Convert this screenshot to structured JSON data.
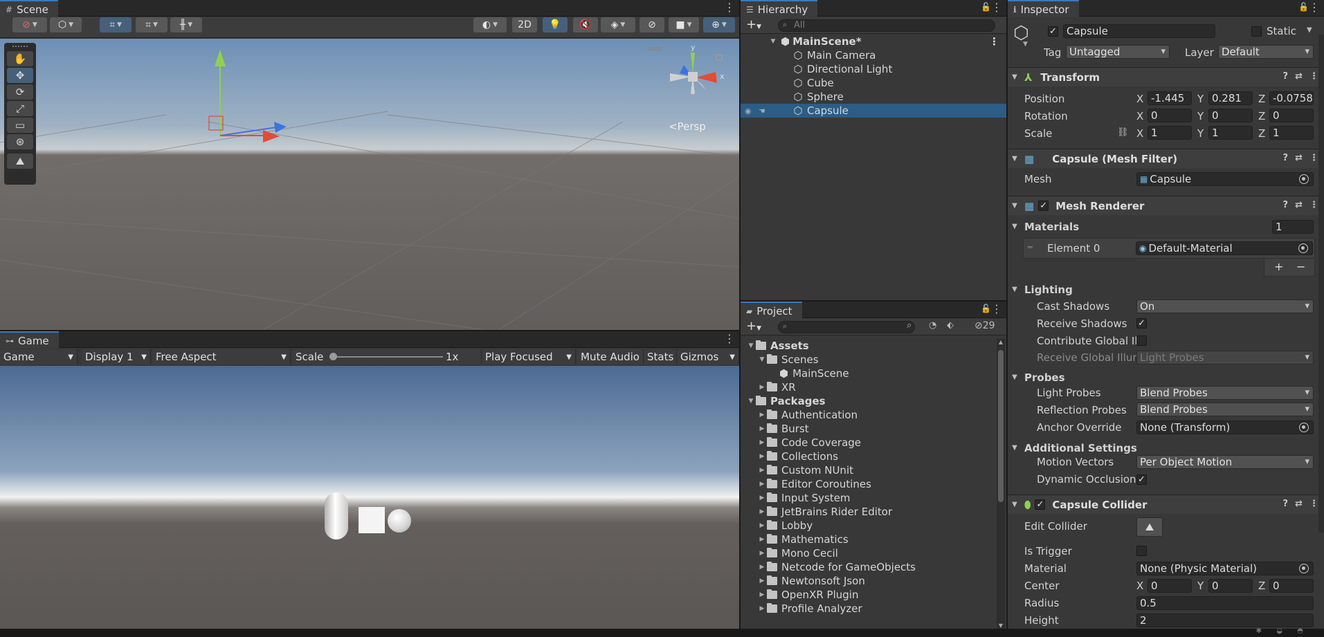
{
  "scene": {
    "tab": "Scene",
    "btn_2d": "2D",
    "persp": "Persp",
    "gizmo_y": "y",
    "gizmo_x": "x"
  },
  "game": {
    "tab": "Game",
    "mode": "Game",
    "display": "Display 1",
    "aspect": "Free Aspect",
    "scale_label": "Scale",
    "scale_value": "1x",
    "play_focused": "Play Focused",
    "mute": "Mute Audio",
    "stats": "Stats",
    "gizmos": "Gizmos"
  },
  "hierarchy": {
    "tab": "Hierarchy",
    "search_placeholder": "All",
    "scene_name": "MainScene*",
    "items": [
      "Main Camera",
      "Directional Light",
      "Cube",
      "Sphere",
      "Capsule"
    ],
    "selected": "Capsule"
  },
  "project": {
    "tab": "Project",
    "hidden_count": "29",
    "assets": "Assets",
    "scenes": "Scenes",
    "main_scene": "MainScene",
    "xr": "XR",
    "packages": "Packages",
    "package_items": [
      "Authentication",
      "Burst",
      "Code Coverage",
      "Collections",
      "Custom NUnit",
      "Editor Coroutines",
      "Input System",
      "JetBrains Rider Editor",
      "Lobby",
      "Mathematics",
      "Mono Cecil",
      "Netcode for GameObjects",
      "Newtonsoft Json",
      "OpenXR Plugin",
      "Profile Analyzer"
    ]
  },
  "inspector": {
    "tab": "Inspector",
    "object_name": "Capsule",
    "static": "Static",
    "tag_label": "Tag",
    "tag": "Untagged",
    "layer_label": "Layer",
    "layer": "Default",
    "transform": {
      "title": "Transform",
      "position_label": "Position",
      "rotation_label": "Rotation",
      "scale_label": "Scale",
      "position": {
        "x": "-1.445",
        "y": "0.281",
        "z": "-0.0758"
      },
      "rotation": {
        "x": "0",
        "y": "0",
        "z": "0"
      },
      "scale": {
        "x": "1",
        "y": "1",
        "z": "1"
      }
    },
    "mesh_filter": {
      "title": "Capsule (Mesh Filter)",
      "mesh_label": "Mesh",
      "mesh": "Capsule"
    },
    "mesh_renderer": {
      "title": "Mesh Renderer",
      "materials_label": "Materials",
      "materials_count": "1",
      "element_label": "Element 0",
      "element_value": "Default-Material",
      "add": "+",
      "remove": "−",
      "lighting_label": "Lighting",
      "cast_shadows_label": "Cast Shadows",
      "cast_shadows": "On",
      "receive_shadows_label": "Receive Shadows",
      "contribute_gi_label": "Contribute Global Il",
      "receive_gi_label": "Receive Global Illur",
      "receive_gi": "Light Probes",
      "probes_label": "Probes",
      "light_probes_label": "Light Probes",
      "light_probes": "Blend Probes",
      "reflection_probes_label": "Reflection Probes",
      "reflection_probes": "Blend Probes",
      "anchor_label": "Anchor Override",
      "anchor": "None (Transform)",
      "additional_label": "Additional Settings",
      "motion_vectors_label": "Motion Vectors",
      "motion_vectors": "Per Object Motion",
      "dynamic_occlusion_label": "Dynamic Occlusion"
    },
    "capsule_collider": {
      "title": "Capsule Collider",
      "edit_label": "Edit Collider",
      "trigger_label": "Is Trigger",
      "material_label": "Material",
      "material": "None (Physic Material)",
      "center_label": "Center",
      "center": {
        "x": "0",
        "y": "0",
        "z": "0"
      },
      "radius_label": "Radius",
      "radius": "0.5",
      "height_label": "Height",
      "height": "2"
    },
    "axes": {
      "x": "X",
      "y": "Y",
      "z": "Z"
    }
  },
  "colors": {
    "selection": "#2c5d87",
    "accent": "#3a79bb",
    "panel": "#383838"
  }
}
